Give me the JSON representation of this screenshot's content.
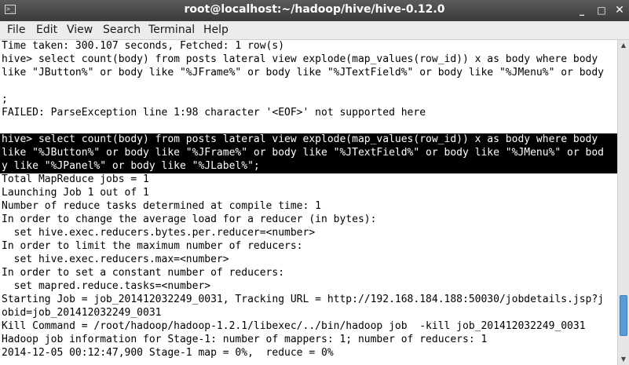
{
  "window": {
    "title": "root@localhost:~/hadoop/hive/hive-0.12.0",
    "icon": "terminal-icon",
    "buttons": {
      "minimize": "_",
      "maximize": "□",
      "close": "✕"
    }
  },
  "menu": [
    "File",
    "Edit",
    "View",
    "Search",
    "Terminal",
    "Help"
  ],
  "terminal": {
    "lines": [
      {
        "text": "Time taken: 300.107 seconds, Fetched: 1 row(s)",
        "selected": false
      },
      {
        "text": "hive> select count(body) from posts lateral view explode(map_values(row_id)) x as body where body",
        "selected": false
      },
      {
        "text": "like \"JButton%\" or body like \"%JFrame%\" or body like \"%JTextField%\" or body like \"%JMenu%\" or body",
        "selected": false
      },
      {
        "text": "",
        "selected": false
      },
      {
        "text": ";",
        "selected": false
      },
      {
        "text": "FAILED: ParseException line 1:98 character '<EOF>' not supported here",
        "selected": false
      },
      {
        "text": "",
        "selected": false
      },
      {
        "text": "hive> select count(body) from posts lateral view explode(map_values(row_id)) x as body where body",
        "selected": true
      },
      {
        "text": "like \"%JButton%\" or body like \"%JFrame%\" or body like \"%JTextField%\" or body like \"%JMenu%\" or bod",
        "selected": true
      },
      {
        "text": "y like \"%JPanel%\" or body like \"%JLabel%\";",
        "selected": true
      },
      {
        "text": "Total MapReduce jobs = 1",
        "selected": false
      },
      {
        "text": "Launching Job 1 out of 1",
        "selected": false
      },
      {
        "text": "Number of reduce tasks determined at compile time: 1",
        "selected": false
      },
      {
        "text": "In order to change the average load for a reducer (in bytes):",
        "selected": false
      },
      {
        "text": "  set hive.exec.reducers.bytes.per.reducer=<number>",
        "selected": false
      },
      {
        "text": "In order to limit the maximum number of reducers:",
        "selected": false
      },
      {
        "text": "  set hive.exec.reducers.max=<number>",
        "selected": false
      },
      {
        "text": "In order to set a constant number of reducers:",
        "selected": false
      },
      {
        "text": "  set mapred.reduce.tasks=<number>",
        "selected": false
      },
      {
        "text": "Starting Job = job_201412032249_0031, Tracking URL = http://192.168.184.188:50030/jobdetails.jsp?j",
        "selected": false
      },
      {
        "text": "obid=job_201412032249_0031",
        "selected": false
      },
      {
        "text": "Kill Command = /root/hadoop/hadoop-1.2.1/libexec/../bin/hadoop job  -kill job_201412032249_0031",
        "selected": false
      },
      {
        "text": "Hadoop job information for Stage-1: number of mappers: 1; number of reducers: 1",
        "selected": false
      },
      {
        "text": "2014-12-05 00:12:47,900 Stage-1 map = 0%,  reduce = 0%",
        "selected": false
      }
    ]
  },
  "scrollbar": {
    "position": 0.93,
    "up_arrow": "▲",
    "down_arrow": "▼"
  }
}
